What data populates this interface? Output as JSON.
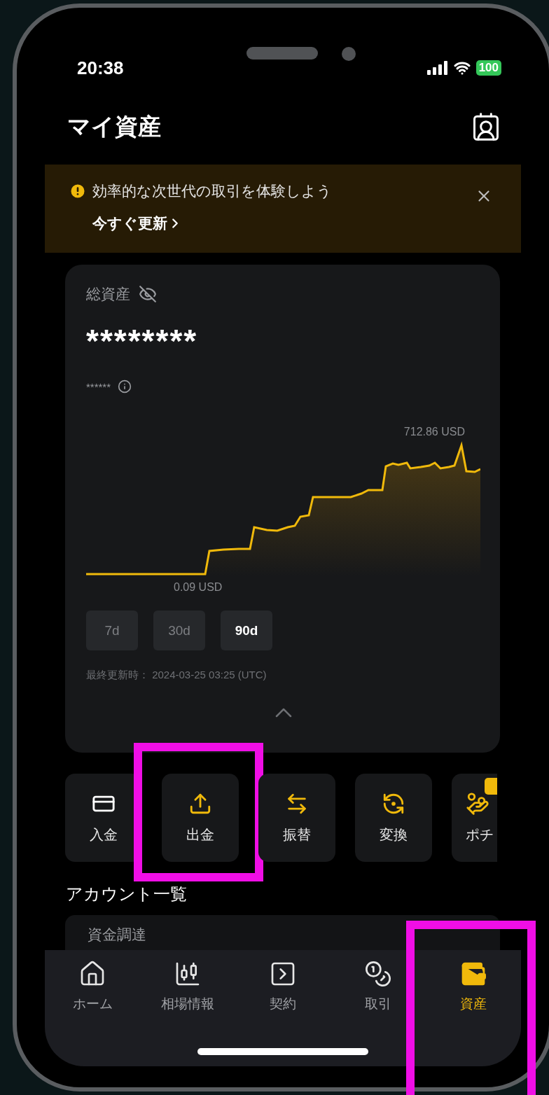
{
  "status_bar": {
    "time": "20:38",
    "battery": "100"
  },
  "header": {
    "title": "マイ資産"
  },
  "banner": {
    "message": "効率的な次世代の取引を体験しよう",
    "link": "今すぐ更新"
  },
  "total": {
    "label": "総資産",
    "hidden": true,
    "value": "********",
    "sub_value": "******"
  },
  "chart": {
    "max_label": "712.86 USD",
    "min_label": "0.09 USD"
  },
  "periods": [
    {
      "label": "7d",
      "selected": false
    },
    {
      "label": "30d",
      "selected": false
    },
    {
      "label": "90d",
      "selected": true
    }
  ],
  "updated": "最終更新時： 2024-03-25 03:25 (UTC)",
  "actions": [
    {
      "label": "入金",
      "cut": false
    },
    {
      "label": "出金",
      "highlighted": true,
      "cut": false
    },
    {
      "label": "振替",
      "cut": false
    },
    {
      "label": "変換",
      "cut": false
    },
    {
      "label": "ポチ",
      "new_badge": true,
      "cut": true
    }
  ],
  "accounts": {
    "title": "アカウント一覧",
    "items": [
      {
        "name": "資金調達"
      }
    ]
  },
  "nav": [
    {
      "label": "ホーム",
      "selected": false
    },
    {
      "label": "相場情報",
      "selected": false
    },
    {
      "label": "契約",
      "selected": false
    },
    {
      "label": "取引",
      "selected": false
    },
    {
      "label": "資産",
      "selected": true,
      "highlighted": true
    }
  ]
}
